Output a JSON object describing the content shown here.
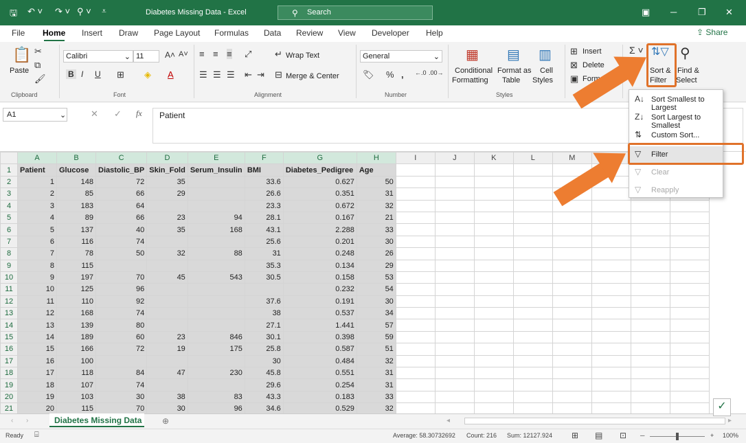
{
  "title_bar": {
    "title": "Diabetes Missing Data  -  Excel",
    "search_placeholder": "Search"
  },
  "menu_tabs": [
    "File",
    "Home",
    "Insert",
    "Draw",
    "Page Layout",
    "Formulas",
    "Data",
    "Review",
    "View",
    "Developer",
    "Help"
  ],
  "share_label": "Share",
  "ribbon": {
    "paste": "Paste",
    "font_name": "Calibri",
    "font_size": "11",
    "wrap_text": "Wrap Text",
    "merge_center": "Merge & Center",
    "number_format": "General",
    "conditional": "Conditional",
    "formatting": "Formatting",
    "format_as": "Format as",
    "table": "Table",
    "cell": "Cell",
    "styles": "Styles",
    "insert": "Insert",
    "delete": "Delete",
    "format": "Form",
    "sort": "Sort &",
    "filter": "Filter",
    "find": "Find &",
    "select": "Select",
    "groups": {
      "clipboard": "Clipboard",
      "font": "Font",
      "alignment": "Alignment",
      "number": "Number",
      "styles": "Styles",
      "cells": "Cells"
    }
  },
  "formula_bar": {
    "name_box": "A1",
    "content": "Patient"
  },
  "columns": [
    "A",
    "B",
    "C",
    "D",
    "E",
    "F",
    "G",
    "H",
    "I",
    "J",
    "K",
    "L",
    "M",
    "N",
    "O",
    "P"
  ],
  "headers": [
    "Patient",
    "Glucose",
    "Diastolic_BP",
    "Skin_Fold",
    "Serum_Insulin",
    "BMI",
    "Diabetes_Pedigree",
    "Age"
  ],
  "rows": [
    [
      "1",
      "148",
      "72",
      "35",
      "",
      "33.6",
      "0.627",
      "50"
    ],
    [
      "2",
      "85",
      "66",
      "29",
      "",
      "26.6",
      "0.351",
      "31"
    ],
    [
      "3",
      "183",
      "64",
      "",
      "",
      "23.3",
      "0.672",
      "32"
    ],
    [
      "4",
      "89",
      "66",
      "23",
      "94",
      "28.1",
      "0.167",
      "21"
    ],
    [
      "5",
      "137",
      "40",
      "35",
      "168",
      "43.1",
      "2.288",
      "33"
    ],
    [
      "6",
      "116",
      "74",
      "",
      "",
      "25.6",
      "0.201",
      "30"
    ],
    [
      "7",
      "78",
      "50",
      "32",
      "88",
      "31",
      "0.248",
      "26"
    ],
    [
      "8",
      "115",
      "",
      "",
      "",
      "35.3",
      "0.134",
      "29"
    ],
    [
      "9",
      "197",
      "70",
      "45",
      "543",
      "30.5",
      "0.158",
      "53"
    ],
    [
      "10",
      "125",
      "96",
      "",
      "",
      "",
      "0.232",
      "54"
    ],
    [
      "11",
      "110",
      "92",
      "",
      "",
      "37.6",
      "0.191",
      "30"
    ],
    [
      "12",
      "168",
      "74",
      "",
      "",
      "38",
      "0.537",
      "34"
    ],
    [
      "13",
      "139",
      "80",
      "",
      "",
      "27.1",
      "1.441",
      "57"
    ],
    [
      "14",
      "189",
      "60",
      "23",
      "846",
      "30.1",
      "0.398",
      "59"
    ],
    [
      "15",
      "166",
      "72",
      "19",
      "175",
      "25.8",
      "0.587",
      "51"
    ],
    [
      "16",
      "100",
      "",
      "",
      "",
      "30",
      "0.484",
      "32"
    ],
    [
      "17",
      "118",
      "84",
      "47",
      "230",
      "45.8",
      "0.551",
      "31"
    ],
    [
      "18",
      "107",
      "74",
      "",
      "",
      "29.6",
      "0.254",
      "31"
    ],
    [
      "19",
      "103",
      "30",
      "38",
      "83",
      "43.3",
      "0.183",
      "33"
    ],
    [
      "20",
      "115",
      "70",
      "30",
      "96",
      "34.6",
      "0.529",
      "32"
    ]
  ],
  "sheet_tab": "Diabetes Missing Data",
  "status": {
    "ready": "Ready",
    "average": "Average: 58.30732692",
    "count": "Count: 216",
    "sum": "Sum: 12127.924",
    "zoom": "100%"
  },
  "dropdown": {
    "sort_asc": "Sort Smallest to Largest",
    "sort_desc": "Sort Largest to Smallest",
    "custom_sort": "Custom Sort...",
    "filter": "Filter",
    "clear": "Clear",
    "reapply": "Reapply"
  },
  "colors": {
    "accent": "#217346",
    "highlight": "#ed7d31"
  }
}
